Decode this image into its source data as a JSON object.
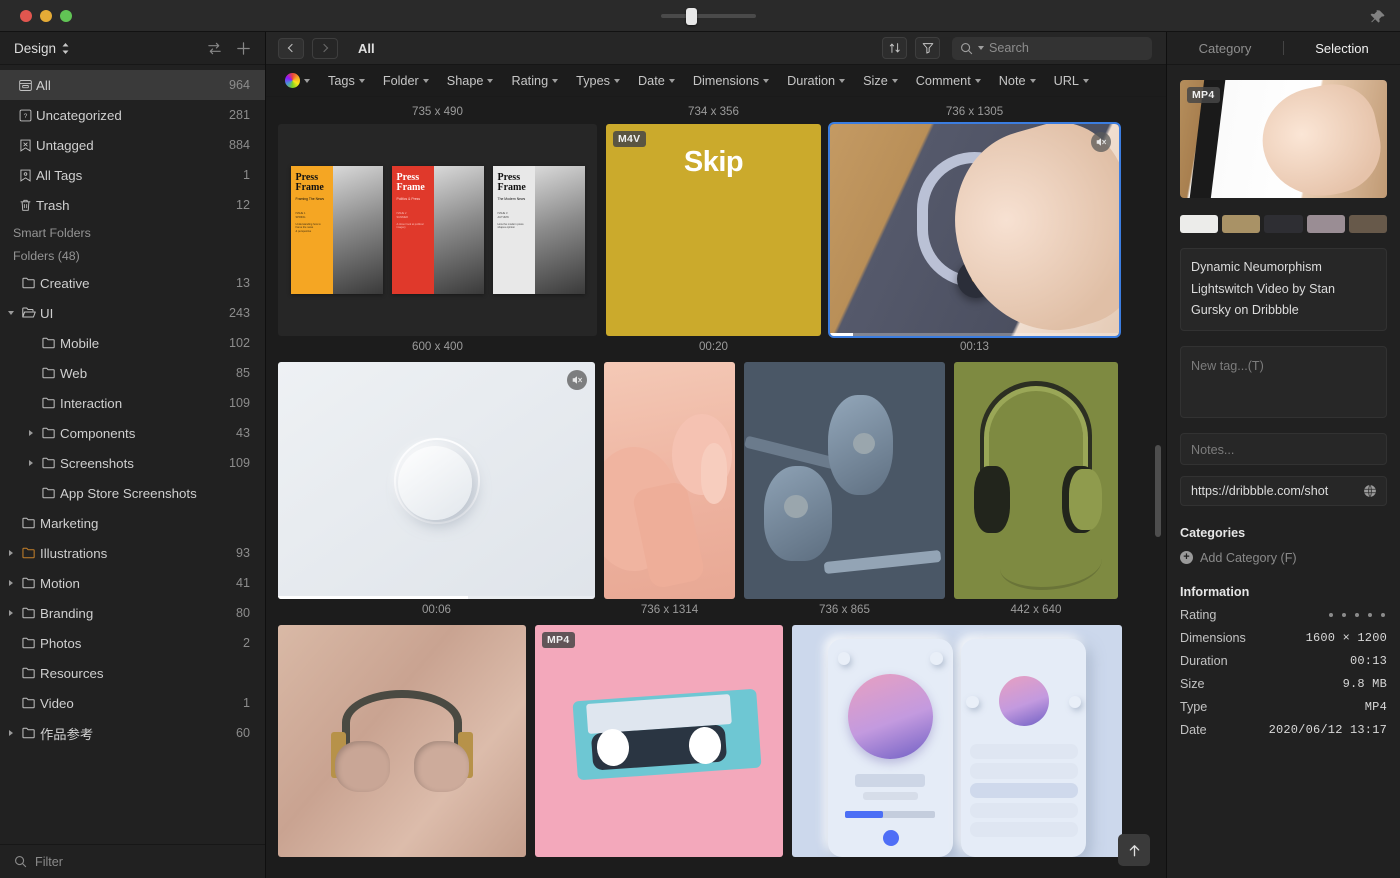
{
  "titlebar": {
    "zoom_thumb_pct": 27,
    "pin_icon": "pin-icon"
  },
  "sidebar": {
    "library_label": "Design",
    "sort_icon": "sort-transfer-icon",
    "add_icon": "plus-icon",
    "filter_placeholder": "Filter",
    "system_items": [
      {
        "label": "All",
        "count": "964",
        "icon": "all-items-icon",
        "selected": true
      },
      {
        "label": "Uncategorized",
        "count": "281",
        "icon": "uncategorized-icon",
        "selected": false
      },
      {
        "label": "Untagged",
        "count": "884",
        "icon": "untagged-icon",
        "selected": false
      },
      {
        "label": "All Tags",
        "count": "1",
        "icon": "all-tags-icon",
        "selected": false
      },
      {
        "label": "Trash",
        "count": "12",
        "icon": "trash-icon",
        "selected": false
      }
    ],
    "smart_folders_label": "Smart Folders",
    "folders_label": "Folders (48)",
    "folders": [
      {
        "label": "Creative",
        "count": "13",
        "depth": 0,
        "twisty": "none",
        "color": "default"
      },
      {
        "label": "UI",
        "count": "243",
        "depth": 0,
        "twisty": "open",
        "color": "default"
      },
      {
        "label": "Mobile",
        "count": "102",
        "depth": 1,
        "twisty": "none",
        "color": "default"
      },
      {
        "label": "Web",
        "count": "85",
        "depth": 1,
        "twisty": "none",
        "color": "default"
      },
      {
        "label": "Interaction",
        "count": "109",
        "depth": 1,
        "twisty": "none",
        "color": "default"
      },
      {
        "label": "Components",
        "count": "43",
        "depth": 1,
        "twisty": "closed",
        "color": "default"
      },
      {
        "label": "Screenshots",
        "count": "109",
        "depth": 1,
        "twisty": "closed",
        "color": "default"
      },
      {
        "label": "App Store Screenshots",
        "count": "",
        "depth": 1,
        "twisty": "none",
        "color": "default"
      },
      {
        "label": "Marketing",
        "count": "",
        "depth": 0,
        "twisty": "none",
        "color": "default"
      },
      {
        "label": "Illustrations",
        "count": "93",
        "depth": 0,
        "twisty": "closed",
        "color": "#c4802a"
      },
      {
        "label": "Motion",
        "count": "41",
        "depth": 0,
        "twisty": "closed",
        "color": "default"
      },
      {
        "label": "Branding",
        "count": "80",
        "depth": 0,
        "twisty": "closed",
        "color": "default"
      },
      {
        "label": "Photos",
        "count": "2",
        "depth": 0,
        "twisty": "none",
        "color": "default"
      },
      {
        "label": "Resources",
        "count": "",
        "depth": 0,
        "twisty": "none",
        "color": "default"
      },
      {
        "label": "Video",
        "count": "1",
        "depth": 0,
        "twisty": "none",
        "color": "default"
      },
      {
        "label": "作品参考",
        "count": "60",
        "depth": 0,
        "twisty": "closed",
        "color": "default"
      }
    ]
  },
  "main": {
    "breadcrumb": "All",
    "back_icon": "chevron-left-icon",
    "forward_icon": "chevron-right-icon",
    "sort_button_icon": "sort-arrows-icon",
    "filter_button_icon": "funnel-icon",
    "search_placeholder": "Search",
    "search_icon": "search-icon",
    "filters": [
      {
        "label": "",
        "icon": "color-wheel-icon"
      },
      {
        "label": "Tags",
        "icon": ""
      },
      {
        "label": "Folder",
        "icon": ""
      },
      {
        "label": "Shape",
        "icon": ""
      },
      {
        "label": "Rating",
        "icon": ""
      },
      {
        "label": "Types",
        "icon": ""
      },
      {
        "label": "Date",
        "icon": ""
      },
      {
        "label": "Dimensions",
        "icon": ""
      },
      {
        "label": "Duration",
        "icon": ""
      },
      {
        "label": "Size",
        "icon": ""
      },
      {
        "label": "Comment",
        "icon": ""
      },
      {
        "label": "Note",
        "icon": ""
      },
      {
        "label": "URL",
        "icon": ""
      }
    ],
    "items": [
      {
        "id": "press-frame",
        "caption_top": "735 x 490",
        "caption_bottom": "600 x 400",
        "badge": "",
        "selected": false,
        "muted": false,
        "progress": 0
      },
      {
        "id": "skip",
        "caption_top": "734 x 356",
        "caption_bottom": "00:20",
        "badge": "M4V",
        "selected": false,
        "muted": false,
        "progress": 0
      },
      {
        "id": "lightswitch",
        "caption_top": "736 x 1305",
        "caption_bottom": "00:13",
        "badge": "",
        "selected": true,
        "muted": true,
        "progress": 8
      },
      {
        "id": "knob",
        "caption_top": "",
        "caption_bottom": "00:06",
        "badge": "",
        "selected": false,
        "muted": true,
        "progress": 60
      },
      {
        "id": "pink-3d",
        "caption_top": "",
        "caption_bottom": "736 x 1314",
        "badge": "",
        "selected": false,
        "muted": false,
        "progress": 0
      },
      {
        "id": "earbuds",
        "caption_top": "",
        "caption_bottom": "736 x 865",
        "badge": "",
        "selected": false,
        "muted": false,
        "progress": 0
      },
      {
        "id": "olive-headphones",
        "caption_top": "",
        "caption_bottom": "442 x 640",
        "badge": "",
        "selected": false,
        "muted": false,
        "progress": 0
      },
      {
        "id": "tan-headphones",
        "caption_top": "",
        "caption_bottom": "",
        "badge": "",
        "selected": false,
        "muted": false,
        "progress": 0
      },
      {
        "id": "cassette",
        "caption_top": "",
        "caption_bottom": "",
        "badge": "MP4",
        "selected": false,
        "muted": false,
        "progress": 0
      },
      {
        "id": "neumorphism-player",
        "caption_top": "",
        "caption_bottom": "",
        "badge": "",
        "selected": false,
        "muted": false,
        "progress": 0
      }
    ],
    "scroll_top_icon": "arrow-up-icon"
  },
  "right_panel": {
    "tab_category": "Category",
    "tab_selection": "Selection",
    "preview_badge": "MP4",
    "swatches": [
      "#ececea",
      "#a99266",
      "#2e2e33",
      "#9a8d94",
      "#67594a"
    ],
    "title": "Dynamic Neumorphism Lightswitch Video by Stan Gursky on Dribbble",
    "tag_placeholder": "New tag...(T)",
    "notes_placeholder": "Notes...",
    "url": "https://dribbble.com/shot",
    "url_icon": "globe-icon",
    "categories_heading": "Categories",
    "add_category_label": "Add Category (F)",
    "information_heading": "Information",
    "information": [
      {
        "key": "Rating",
        "value": "",
        "stars": 5
      },
      {
        "key": "Dimensions",
        "value": "1600 × 1200"
      },
      {
        "key": "Duration",
        "value": "00:13"
      },
      {
        "key": "Size",
        "value": "9.8 MB"
      },
      {
        "key": "Type",
        "value": "MP4"
      },
      {
        "key": "Date",
        "value": "2020/06/12 13:17"
      }
    ]
  }
}
